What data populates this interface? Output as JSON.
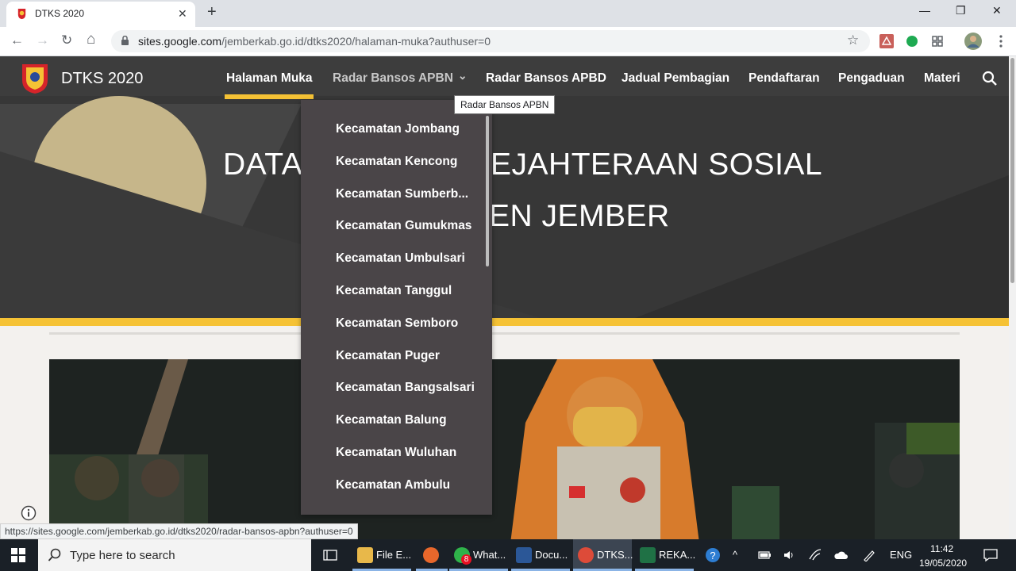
{
  "browser": {
    "tab_title": "DTKS 2020",
    "tab_close": "✕",
    "new_tab": "+",
    "url_host": "sites.google.com",
    "url_path": "/jemberkab.go.id/dtks2020/halaman-muka?authuser=0",
    "status_url": "https://sites.google.com/jemberkab.go.id/dtks2020/radar-bansos-apbn?authuser=0",
    "win_min": "—",
    "win_restore": "❐",
    "win_close": "✕",
    "back": "←",
    "forward": "→",
    "reload": "↻",
    "home": "⌂",
    "star": "☆"
  },
  "site": {
    "title": "DTKS 2020",
    "nav": [
      {
        "label": "Halaman Muka"
      },
      {
        "label": "Radar Bansos APBN"
      },
      {
        "label": "Radar Bansos APBD"
      },
      {
        "label": "Jadual Pembagian"
      },
      {
        "label": "Pendaftaran"
      },
      {
        "label": "Pengaduan"
      },
      {
        "label": "Materi"
      }
    ],
    "nav_chevron": "⌄",
    "tooltip": "Radar Bansos APBN",
    "hero_line1_left": "DATA T",
    "hero_line1_right": "EJAHTERAAN SOSIAL",
    "hero_line2_right": "EN JEMBER",
    "dropdown": [
      "Kecamatan Jombang",
      "Kecamatan Kencong",
      "Kecamatan Sumberb...",
      "Kecamatan Gumukmas",
      "Kecamatan Umbulsari",
      "Kecamatan Tanggul",
      "Kecamatan Semboro",
      "Kecamatan Puger",
      "Kecamatan Bangsalsari",
      "Kecamatan Balung",
      "Kecamatan Wuluhan",
      "Kecamatan Ambulu"
    ]
  },
  "taskbar": {
    "search_placeholder": "Type here to search",
    "apps": [
      {
        "label": "File E...",
        "color": "#e8b84a"
      },
      {
        "label": "",
        "color": "#e8672b"
      },
      {
        "label": "What...",
        "color": "#2fb34a",
        "badge": "8"
      },
      {
        "label": "Docu...",
        "color": "#2b5797"
      },
      {
        "label": "DTKS...",
        "color": "#dd4b39"
      },
      {
        "label": "REKA...",
        "color": "#1f7145"
      }
    ],
    "tray_lang": "ENG",
    "time": "11:42",
    "date": "19/05/2020"
  },
  "colors": {
    "accent": "#f5c235",
    "hero_bg": "#3d3d3d",
    "dropdown_bg": "#4a4548"
  }
}
